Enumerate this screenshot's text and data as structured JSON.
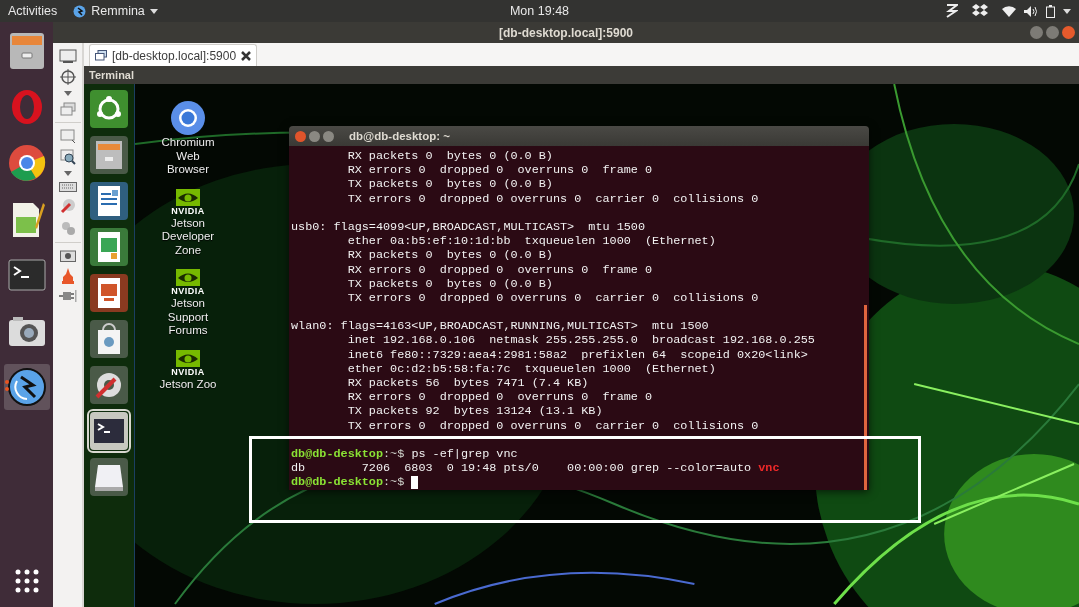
{
  "top_bar": {
    "activities": "Activities",
    "app_menu": "Remmina",
    "clock": "Mon 19:48"
  },
  "dock": {
    "items": [
      {
        "kind": "files",
        "running": false
      },
      {
        "kind": "opera",
        "running": false
      },
      {
        "kind": "chrome",
        "running": false
      },
      {
        "kind": "editor",
        "running": false
      },
      {
        "kind": "terminal",
        "running": false
      },
      {
        "kind": "camera",
        "running": false
      },
      {
        "kind": "remmina",
        "running": true
      }
    ]
  },
  "window": {
    "title": "[db-desktop.local]:5900",
    "tabs": [
      {
        "label": "[db-desktop.local]:5900",
        "selected": true
      }
    ]
  },
  "remote": {
    "top_panel": {
      "title": "Terminal"
    },
    "dock": {
      "items": [
        {
          "kind": "ubuntu",
          "running": false
        },
        {
          "kind": "files",
          "running": false
        },
        {
          "kind": "writer",
          "running": false
        },
        {
          "kind": "calc",
          "running": false
        },
        {
          "kind": "impress",
          "running": false
        },
        {
          "kind": "software",
          "running": false
        },
        {
          "kind": "settings",
          "running": false
        },
        {
          "kind": "terminal",
          "running": true
        },
        {
          "kind": "disk",
          "running": false
        }
      ]
    },
    "desktop_icons": [
      {
        "kind": "chromium",
        "label": "Chromium\nWeb\nBrowser"
      },
      {
        "kind": "nvidia",
        "brand": "NVIDIA",
        "label": "Jetson\nDeveloper\nZone"
      },
      {
        "kind": "nvidia",
        "brand": "NVIDIA",
        "label": "Jetson\nSupport\nForums"
      },
      {
        "kind": "nvidia",
        "brand": "NVIDIA",
        "label": "Jetson Zoo"
      }
    ],
    "terminal": {
      "title": "db@db-desktop: ~",
      "lines": [
        {
          "kind": "output",
          "text": "        RX packets 0  bytes 0 (0.0 B)"
        },
        {
          "kind": "output",
          "text": "        RX errors 0  dropped 0  overruns 0  frame 0"
        },
        {
          "kind": "output",
          "text": "        TX packets 0  bytes 0 (0.0 B)"
        },
        {
          "kind": "output",
          "text": "        TX errors 0  dropped 0 overruns 0  carrier 0  collisions 0"
        },
        {
          "kind": "blank"
        },
        {
          "kind": "output",
          "text": "usb0: flags=4099<UP,BROADCAST,MULTICAST>  mtu 1500"
        },
        {
          "kind": "output",
          "text": "        ether 0a:b5:ef:10:1d:bb  txqueuelen 1000  (Ethernet)"
        },
        {
          "kind": "output",
          "text": "        RX packets 0  bytes 0 (0.0 B)"
        },
        {
          "kind": "output",
          "text": "        RX errors 0  dropped 0  overruns 0  frame 0"
        },
        {
          "kind": "output",
          "text": "        TX packets 0  bytes 0 (0.0 B)"
        },
        {
          "kind": "output",
          "text": "        TX errors 0  dropped 0 overruns 0  carrier 0  collisions 0"
        },
        {
          "kind": "blank"
        },
        {
          "kind": "output",
          "text": "wlan0: flags=4163<UP,BROADCAST,RUNNING,MULTICAST>  mtu 1500"
        },
        {
          "kind": "output",
          "text": "        inet 192.168.0.106  netmask 255.255.255.0  broadcast 192.168.0.255"
        },
        {
          "kind": "output",
          "text": "        inet6 fe80::7329:aea4:2981:58a2  prefixlen 64  scopeid 0x20<link>"
        },
        {
          "kind": "output",
          "text": "        ether 0c:d2:b5:58:fa:7c  txqueuelen 1000  (Ethernet)"
        },
        {
          "kind": "output",
          "text": "        RX packets 56  bytes 7471 (7.4 KB)"
        },
        {
          "kind": "output",
          "text": "        RX errors 0  dropped 0  overruns 0  frame 0"
        },
        {
          "kind": "output",
          "text": "        TX packets 92  bytes 13124 (13.1 KB)"
        },
        {
          "kind": "output",
          "text": "        TX errors 0  dropped 0 overruns 0  carrier 0  collisions 0"
        },
        {
          "kind": "blank"
        },
        {
          "kind": "prompt",
          "user": "db@db-desktop",
          "path": ":~$",
          "command": "ps -ef|grep vnc",
          "cursor": false
        },
        {
          "kind": "match",
          "text": "db        7206  6803  0 19:48 pts/0    00:00:00 grep --color=auto",
          "match": "vnc"
        },
        {
          "kind": "prompt",
          "user": "db@db-desktop",
          "path": ":~$",
          "cursor": true
        }
      ]
    }
  }
}
